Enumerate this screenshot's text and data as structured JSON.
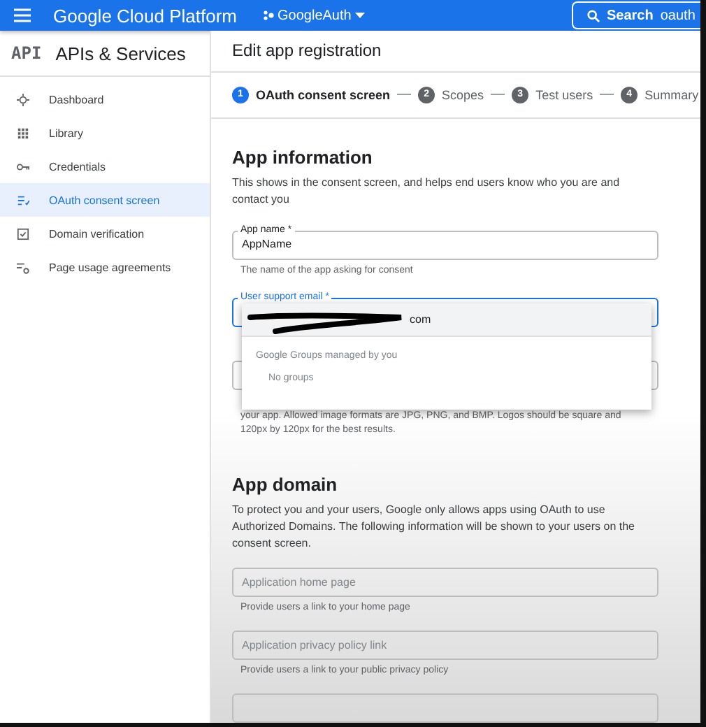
{
  "topbar": {
    "title": "Google Cloud Platform",
    "project": "GoogleAuth",
    "search": {
      "label": "Search",
      "value": "oauth"
    }
  },
  "sidebar": {
    "logo": "API",
    "title": "APIs & Services",
    "items": [
      {
        "label": "Dashboard",
        "selected": false
      },
      {
        "label": "Library",
        "selected": false
      },
      {
        "label": "Credentials",
        "selected": false
      },
      {
        "label": "OAuth consent screen",
        "selected": true
      },
      {
        "label": "Domain verification",
        "selected": false
      },
      {
        "label": "Page usage agreements",
        "selected": false
      }
    ]
  },
  "main": {
    "title": "Edit app registration",
    "steps": [
      {
        "number": "1",
        "label": "OAuth consent screen",
        "selected": true
      },
      {
        "number": "2",
        "label": "Scopes",
        "selected": false
      },
      {
        "number": "3",
        "label": "Test users",
        "selected": false
      },
      {
        "number": "4",
        "label": "Summary",
        "selected": false
      }
    ],
    "app_information": {
      "heading": "App information",
      "description": "This shows in the consent screen, and helps end users know who you are and contact you",
      "app_name": {
        "label": "App name *",
        "value": "AppName",
        "hint": "The name of the app asking for consent"
      },
      "support_email": {
        "label": "User support email *",
        "focused": true
      },
      "dropdown": {
        "option": "com",
        "group_heading": "Google Groups managed by you",
        "empty": "No groups"
      },
      "logo_hint": "your app. Allowed image formats are JPG, PNG, and BMP. Logos should be square and 120px by 120px for the best results."
    },
    "app_domain": {
      "heading": "App domain",
      "description": "To protect you and your users, Google only allows apps using OAuth to use Authorized Domains. The following information will be shown to your users on the consent screen.",
      "fields": [
        {
          "placeholder": "Application home page",
          "hint": "Provide users a link to your home page"
        },
        {
          "placeholder": "Application privacy policy link",
          "hint": "Provide users a link to your public privacy policy"
        }
      ]
    }
  }
}
